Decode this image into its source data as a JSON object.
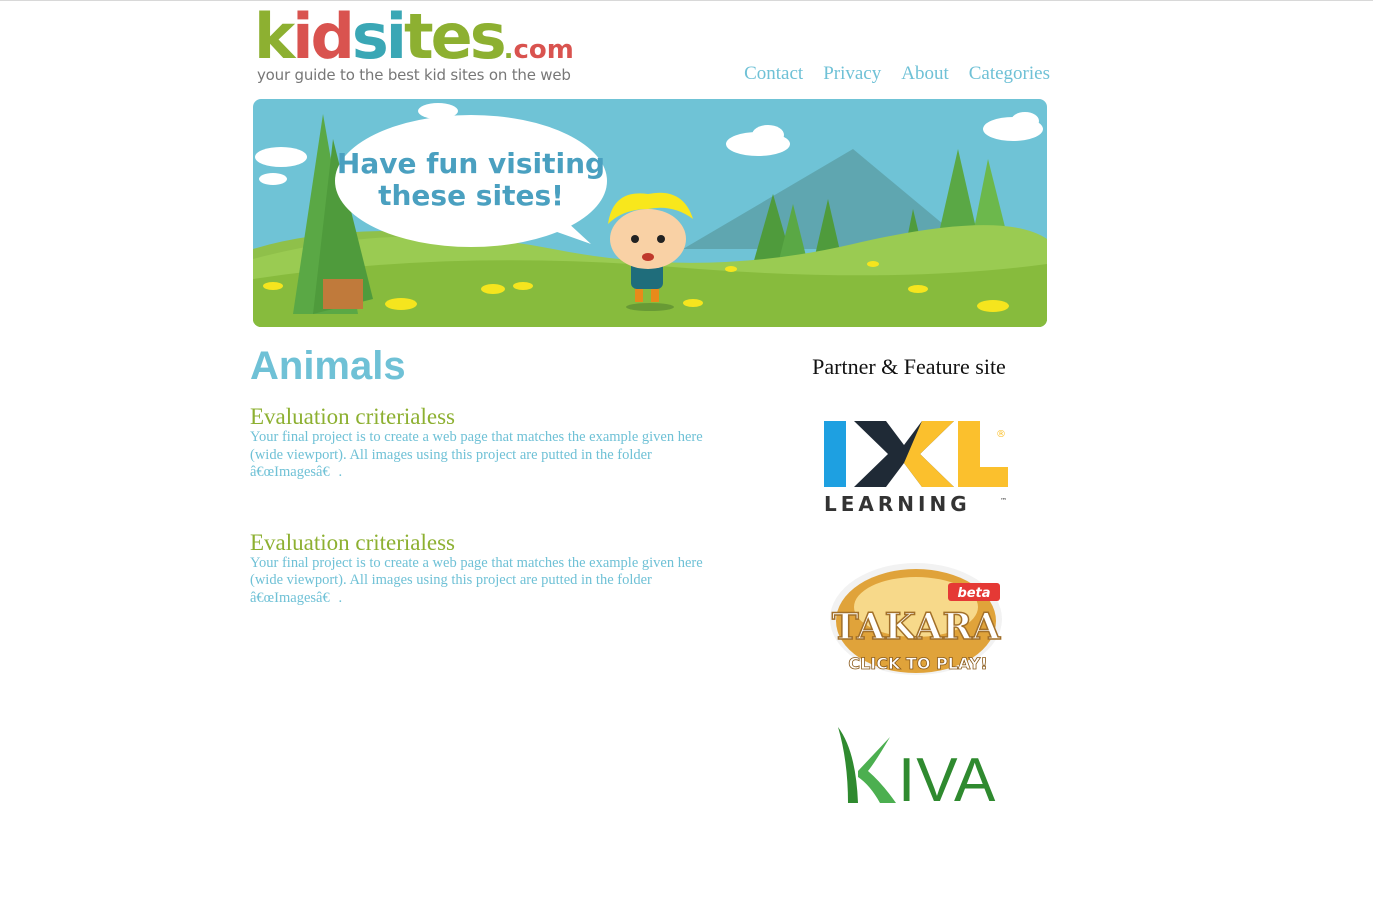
{
  "logo": {
    "parts": [
      "k",
      "id",
      "si",
      "tes"
    ],
    "dot": ".",
    "suffix": "com",
    "tagline": "your guide to the best kid sites on the web"
  },
  "nav": {
    "items": [
      {
        "label": "Contact"
      },
      {
        "label": "Privacy"
      },
      {
        "label": "About"
      },
      {
        "label": "Categories"
      }
    ]
  },
  "banner": {
    "speech_line1": "Have fun visiting",
    "speech_line2": "these sites!"
  },
  "main": {
    "title": "Animals",
    "articles": [
      {
        "heading": "Evaluation criterialess",
        "body": "Your final project is to create a web page that matches the example given here (wide viewport). All images using this project are putted in the folder â€œImagesâ€."
      },
      {
        "heading": "Evaluation criterialess",
        "body": "Your final project is to create a web page that matches the example given here (wide viewport). All images using this project are putted in the folder â€œImagesâ€."
      }
    ]
  },
  "sidebar": {
    "title": "Partner & Feature site",
    "partners": [
      {
        "name": "IXL",
        "word": "IXL",
        "sub": "LEARNING",
        "reg": "®",
        "tm": "™"
      },
      {
        "name": "Takara",
        "word": "TAKARA",
        "badge": "beta",
        "cta": "CLICK TO PLAY!"
      },
      {
        "name": "Kiva",
        "word": "IVA"
      }
    ]
  },
  "colors": {
    "accent_blue": "#6fc1d6",
    "accent_green": "#8db031",
    "accent_red": "#d9534f",
    "ixl_blue": "#1ea0e1",
    "ixl_yellow": "#fbc02d",
    "kiva_green": "#2f8a2f"
  }
}
